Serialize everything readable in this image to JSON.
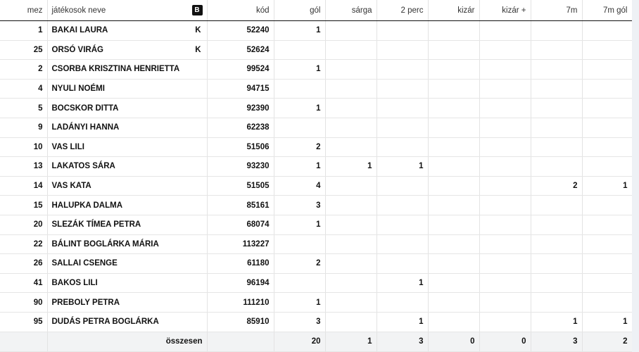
{
  "headers": {
    "mez": "mez",
    "name": "játékosok neve",
    "team_badge": "B",
    "kod": "kód",
    "gol": "gól",
    "sarga": "sárga",
    "ketperc": "2 perc",
    "kizar": "kizár",
    "kizar_plus": "kizár +",
    "hetm": "7m",
    "hetm_gol": "7m gól"
  },
  "players": [
    {
      "mez": "1",
      "name": "BAKAI LAURA",
      "cap": "K",
      "kod": "52240",
      "gol": "1",
      "sarga": "",
      "ketperc": "",
      "kizar": "",
      "kizar_plus": "",
      "hetm": "",
      "hetm_gol": ""
    },
    {
      "mez": "25",
      "name": "ORSÓ VIRÁG",
      "cap": "K",
      "kod": "52624",
      "gol": "",
      "sarga": "",
      "ketperc": "",
      "kizar": "",
      "kizar_plus": "",
      "hetm": "",
      "hetm_gol": ""
    },
    {
      "mez": "2",
      "name": "CSORBA KRISZTINA HENRIETTA",
      "cap": "",
      "kod": "99524",
      "gol": "1",
      "sarga": "",
      "ketperc": "",
      "kizar": "",
      "kizar_plus": "",
      "hetm": "",
      "hetm_gol": ""
    },
    {
      "mez": "4",
      "name": "NYULI NOÉMI",
      "cap": "",
      "kod": "94715",
      "gol": "",
      "sarga": "",
      "ketperc": "",
      "kizar": "",
      "kizar_plus": "",
      "hetm": "",
      "hetm_gol": ""
    },
    {
      "mez": "5",
      "name": "BOCSKOR DITTA",
      "cap": "",
      "kod": "92390",
      "gol": "1",
      "sarga": "",
      "ketperc": "",
      "kizar": "",
      "kizar_plus": "",
      "hetm": "",
      "hetm_gol": ""
    },
    {
      "mez": "9",
      "name": "LADÁNYI HANNA",
      "cap": "",
      "kod": "62238",
      "gol": "",
      "sarga": "",
      "ketperc": "",
      "kizar": "",
      "kizar_plus": "",
      "hetm": "",
      "hetm_gol": ""
    },
    {
      "mez": "10",
      "name": "VAS LILI",
      "cap": "",
      "kod": "51506",
      "gol": "2",
      "sarga": "",
      "ketperc": "",
      "kizar": "",
      "kizar_plus": "",
      "hetm": "",
      "hetm_gol": ""
    },
    {
      "mez": "13",
      "name": "LAKATOS SÁRA",
      "cap": "",
      "kod": "93230",
      "gol": "1",
      "sarga": "1",
      "ketperc": "1",
      "kizar": "",
      "kizar_plus": "",
      "hetm": "",
      "hetm_gol": ""
    },
    {
      "mez": "14",
      "name": "VAS KATA",
      "cap": "",
      "kod": "51505",
      "gol": "4",
      "sarga": "",
      "ketperc": "",
      "kizar": "",
      "kizar_plus": "",
      "hetm": "2",
      "hetm_gol": "1"
    },
    {
      "mez": "15",
      "name": "HALUPKA DALMA",
      "cap": "",
      "kod": "85161",
      "gol": "3",
      "sarga": "",
      "ketperc": "",
      "kizar": "",
      "kizar_plus": "",
      "hetm": "",
      "hetm_gol": ""
    },
    {
      "mez": "20",
      "name": "SLEZÁK TÍMEA PETRA",
      "cap": "",
      "kod": "68074",
      "gol": "1",
      "sarga": "",
      "ketperc": "",
      "kizar": "",
      "kizar_plus": "",
      "hetm": "",
      "hetm_gol": ""
    },
    {
      "mez": "22",
      "name": "BÁLINT BOGLÁRKA MÁRIA",
      "cap": "",
      "kod": "113227",
      "gol": "",
      "sarga": "",
      "ketperc": "",
      "kizar": "",
      "kizar_plus": "",
      "hetm": "",
      "hetm_gol": ""
    },
    {
      "mez": "26",
      "name": "SALLAI CSENGE",
      "cap": "",
      "kod": "61180",
      "gol": "2",
      "sarga": "",
      "ketperc": "",
      "kizar": "",
      "kizar_plus": "",
      "hetm": "",
      "hetm_gol": ""
    },
    {
      "mez": "41",
      "name": "BAKOS LILI",
      "cap": "",
      "kod": "96194",
      "gol": "",
      "sarga": "",
      "ketperc": "1",
      "kizar": "",
      "kizar_plus": "",
      "hetm": "",
      "hetm_gol": ""
    },
    {
      "mez": "90",
      "name": "PREBOLY PETRA",
      "cap": "",
      "kod": "111210",
      "gol": "1",
      "sarga": "",
      "ketperc": "",
      "kizar": "",
      "kizar_plus": "",
      "hetm": "",
      "hetm_gol": ""
    },
    {
      "mez": "95",
      "name": "DUDÁS PETRA BOGLÁRKA",
      "cap": "",
      "kod": "85910",
      "gol": "3",
      "sarga": "",
      "ketperc": "1",
      "kizar": "",
      "kizar_plus": "",
      "hetm": "1",
      "hetm_gol": "1"
    }
  ],
  "totals": {
    "label": "összesen",
    "gol": "20",
    "sarga": "1",
    "ketperc": "3",
    "kizar": "0",
    "kizar_plus": "0",
    "hetm": "3",
    "hetm_gol": "2"
  }
}
